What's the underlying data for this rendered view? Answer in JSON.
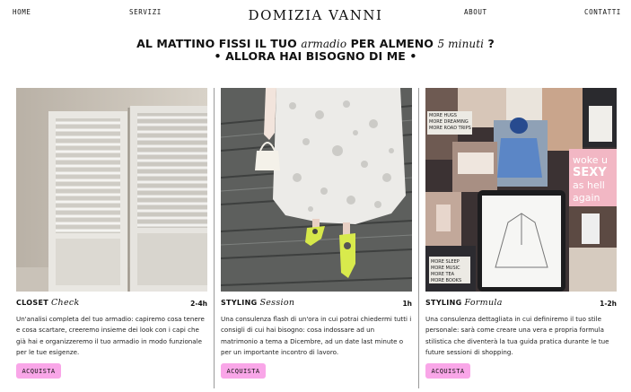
{
  "nav": {
    "home": "HOME",
    "servizi": "SERVIZI",
    "brand": "DOMIZIA VANNI",
    "about": "ABOUT",
    "contatti": "CONTATTI"
  },
  "headline": {
    "line1_a": "AL MATTINO FISSI IL TUO",
    "line1_script1": "armadio",
    "line1_b": "PER ALMENO",
    "line1_script2": "5 minuti",
    "line1_c": "?",
    "line2": "• ALLORA HAI BISOGNO DI ME •"
  },
  "cards": [
    {
      "title": "CLOSET",
      "title_script": "Check",
      "duration": "2-4h",
      "description": "Un'analisi completa del tuo armadio: capiremo cosa tenere e cosa scartare, creeremo insieme dei look con i capi che già hai e organizzeremo il tuo armadio in modo funzionale per le tue esigenze.",
      "button": "ACQUISTA"
    },
    {
      "title": "STYLING",
      "title_script": "Session",
      "duration": "1h",
      "description": "Una consulenza flash di un'ora in cui potrai chiedermi tutti i consigli di cui hai bisogno: cosa indossare ad un matrimonio a tema a Dicembre, ad un date last minute o per un importante incontro di lavoro.",
      "button": "ACQUISTA"
    },
    {
      "title": "STYLING",
      "title_script": "Formula",
      "duration": "1-2h",
      "description": "Una consulenza dettagliata in cui definiremo il tuo stile personale: sarà come creare una vera e propria formula stilistica che diventerà la tua guida pratica durante le tue future sessioni di shopping.",
      "button": "ACQUISTA"
    }
  ],
  "collage": {
    "sticker1": [
      "MORE HUGS",
      "MORE DREAMING",
      "MORE ROAD TRIPS"
    ],
    "poster": [
      "woke u",
      "SEXY",
      "as hell",
      "again"
    ],
    "sticker2": [
      "MORE SLEEP",
      "MORE MUSIC",
      "MORE TEA",
      "MORE BOOKS"
    ]
  },
  "colors": {
    "button_bg": "#f9a6e8",
    "divider": "#9a9a9a",
    "text": "#111111"
  }
}
